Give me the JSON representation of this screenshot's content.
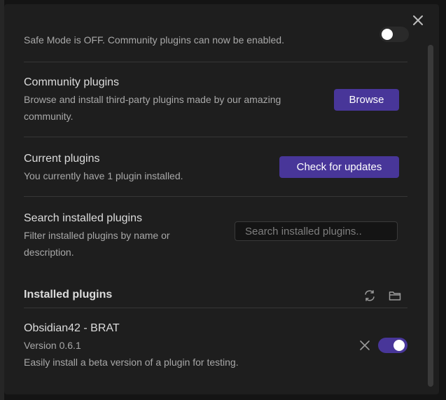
{
  "dialog": {
    "close_icon": "close-icon"
  },
  "safe_mode": {
    "text": "Safe Mode is OFF. Community plugins can now be enabled.",
    "toggle_state": "off"
  },
  "community_plugins": {
    "name": "Community plugins",
    "desc": "Browse and install third-party plugins made by our amazing community.",
    "button_label": "Browse"
  },
  "current_plugins": {
    "name": "Current plugins",
    "desc": "You currently have 1 plugin installed.",
    "button_label": "Check for updates"
  },
  "search_plugins": {
    "name": "Search installed plugins",
    "desc": "Filter installed plugins by name or description.",
    "placeholder": "Search installed plugins..",
    "value": ""
  },
  "installed_plugins": {
    "heading": "Installed plugins",
    "reload_icon": "reload-icon",
    "folder_icon": "folder-icon",
    "items": [
      {
        "name": "Obsidian42 - BRAT",
        "version": "Version 0.6.1",
        "desc": "Easily install a beta version of a plugin for testing.",
        "uninstall_icon": "close-icon",
        "enabled": true
      }
    ]
  },
  "colors": {
    "accent": "#483699",
    "background": "#1e1e1e",
    "text_normal": "#dcdcdc",
    "text_muted": "#a8a8a8",
    "divider": "#363636"
  }
}
